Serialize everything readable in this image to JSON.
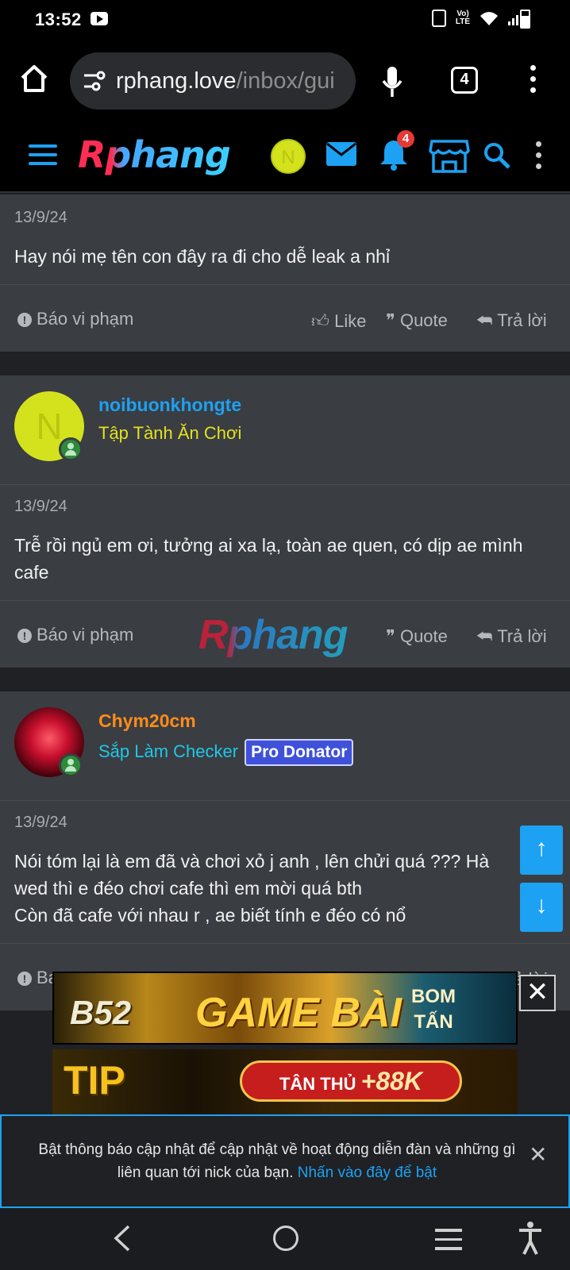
{
  "status_bar": {
    "time": "13:52",
    "network": "Vo) LTE"
  },
  "browser": {
    "url_host": "rphang.love",
    "url_path": "/inbox/gui",
    "tab_count": "4"
  },
  "site": {
    "logo": "Rphang",
    "user_initial": "N",
    "notification_count": "4"
  },
  "posts": [
    {
      "date": "13/9/24",
      "text": "Hay nói mẹ tên con đây ra đi cho dễ leak a nhỉ",
      "actions": {
        "report": "Báo vi phạm",
        "like": "Like",
        "quote": "Quote",
        "reply": "Trả lời"
      }
    },
    {
      "username": "noibuonkhongte",
      "avatar_initial": "N",
      "user_title": "Tập Tành Ăn Chơi",
      "date": "13/9/24",
      "text": "Trễ rồi ngủ em ơi, tưởng ai xa lạ, toàn ae quen, có dịp ae mình cafe",
      "actions": {
        "report": "Báo vi phạm",
        "quote": "Quote",
        "reply": "Trả lời"
      }
    },
    {
      "username": "Chym20cm",
      "user_title": "Sắp Làm Checker",
      "badge": "Pro Donator",
      "date": "13/9/24",
      "text": "Nói tóm lại là em đã và chơi xỏ j anh , lên chửi quá ??? Hà\nwed thì e đéo chơi cafe thì em mời quá bth\nCòn đã cafe với nhau r , ae biết tính e đéo có nổ",
      "actions": {
        "report": "Ba",
        "reply": "rả lời"
      }
    }
  ],
  "watermark": "Rphang",
  "ads": {
    "banner1": {
      "brand": "B52",
      "title": "GAME BÀI",
      "tag_line1": "BOM",
      "tag_line2": "TẤN"
    },
    "banner2": {
      "brand": "TIP",
      "offer_label": "TÂN THỦ",
      "offer_value": "+88K"
    }
  },
  "notification": {
    "text": "Bật thông báo cập nhật để cập nhật về hoạt động diễn đàn và những gì liên quan tới nick của bạn.",
    "link": "Nhấn vào đây để bật"
  },
  "colors": {
    "accent": "#1da1f2",
    "username_blue": "#1da1f2",
    "title_yellow": "#e3e21d",
    "username_orange": "#ff8c1a",
    "title_cyan": "#1fc8e6"
  }
}
